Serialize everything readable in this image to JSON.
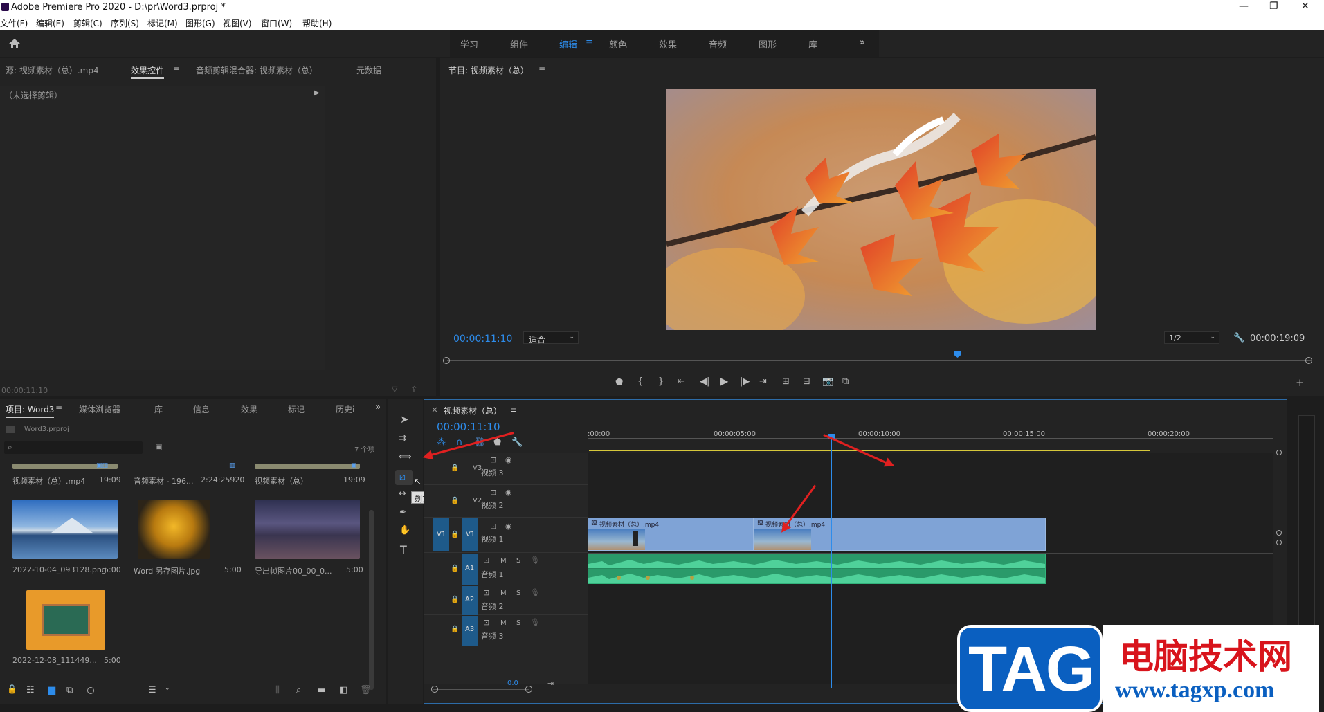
{
  "window": {
    "title": "Adobe Premiere Pro 2020 - D:\\pr\\Word3.prproj *",
    "min": "—",
    "max": "❐",
    "close": "✕"
  },
  "menu": [
    "文件(F)",
    "编辑(E)",
    "剪辑(C)",
    "序列(S)",
    "标记(M)",
    "图形(G)",
    "视图(V)",
    "窗口(W)",
    "帮助(H)"
  ],
  "workspaces": {
    "tabs": [
      "学习",
      "组件",
      "编辑",
      "颜色",
      "效果",
      "音频",
      "图形",
      "库"
    ],
    "active": "编辑",
    "more": "»"
  },
  "source_panel": {
    "tabs": [
      "源: 视频素材（总）.mp4",
      "效果控件",
      "音频剪辑混合器: 视频素材（总）",
      "元数据"
    ],
    "active": "效果控件",
    "no_clip": "（未选择剪辑）",
    "timecode": "00:00:11:10"
  },
  "program_panel": {
    "title": "节目: 视频素材（总）",
    "timecode": "00:00:11:10",
    "fit": "适合",
    "resolution": "1/2",
    "duration": "00:00:19:09",
    "playhead_fraction": 0.59
  },
  "project_panel": {
    "tabs": [
      "项目: Word3",
      "媒体浏览器",
      "库",
      "信息",
      "效果",
      "标记",
      "历史i"
    ],
    "active": "项目: Word3",
    "file": "Word3.prproj",
    "count": "7 个项",
    "items_row0": [
      {
        "name": "视频素材（总）.mp4",
        "dur": "19:09"
      },
      {
        "name": "音频素材 - 196...",
        "dur": "2:24:25920"
      },
      {
        "name": "视频素材（总）",
        "dur": "19:09"
      }
    ],
    "items": [
      {
        "name": "2022-10-04_093128.png",
        "dur": "5:00"
      },
      {
        "name": "Word 另存图片.jpg",
        "dur": "5:00"
      },
      {
        "name": "导出帧图片00_00_0...",
        "dur": "5:00"
      },
      {
        "name": "2022-12-08_111449...",
        "dur": "5:00"
      }
    ]
  },
  "tools": {
    "tooltip": "剃刀工具 (C)",
    "more": "»"
  },
  "timeline": {
    "title": "视频素材（总）",
    "timecode": "00:00:11:10",
    "ruler": [
      ":00:00",
      "00:00:05:00",
      "00:00:10:00",
      "00:00:15:00",
      "00:00:20:00"
    ],
    "tracks_video": [
      {
        "id": "V3",
        "name": "视频 3"
      },
      {
        "id": "V2",
        "name": "视频 2"
      },
      {
        "id": "V1",
        "name": "视频 1",
        "src": "V1"
      }
    ],
    "tracks_audio": [
      {
        "id": "A1",
        "name": "音频 1"
      },
      {
        "id": "A2",
        "name": "音频 2"
      },
      {
        "id": "A3",
        "name": "音频 3"
      }
    ],
    "clips": [
      "视频素材（总）.mp4",
      "视频素材（总）.mp4"
    ],
    "mute": "M",
    "solo": "S",
    "bottom_tc": "0.0"
  },
  "watermark": {
    "logo": "TAG",
    "cn": "电脑技术网",
    "url": "www.tagxp.com"
  },
  "colors": {
    "accent": "#2d8ceb",
    "bg": "#1d1d1d",
    "clip_video": "#7fa3d6",
    "clip_audio": "#2a9a6a"
  }
}
